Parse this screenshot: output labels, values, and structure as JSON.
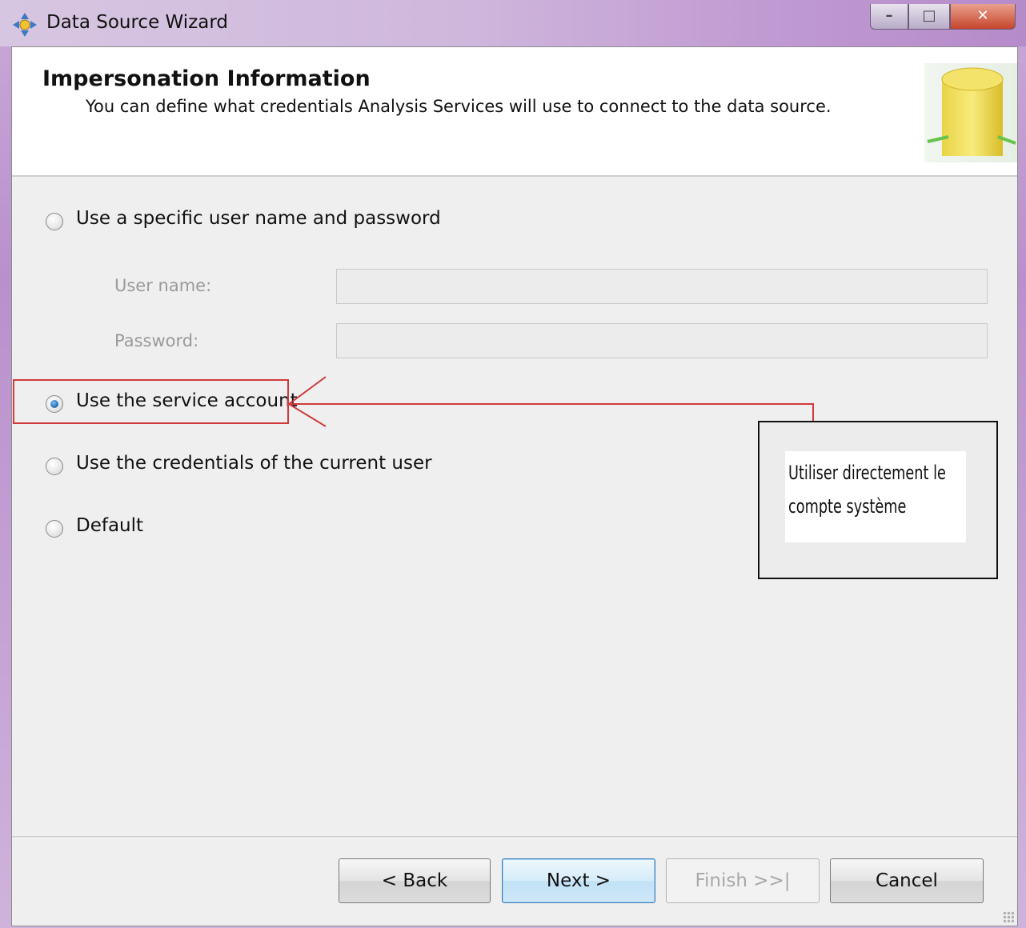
{
  "window": {
    "title": "Data Source Wizard",
    "icon": "wizard-app-icon",
    "controls": {
      "minimize": "minimize-icon",
      "maximize": "maximize-icon",
      "close": "close-icon"
    }
  },
  "header": {
    "title": "Impersonation Information",
    "subtitle": "You can define what credentials Analysis Services will use to connect to the data source.",
    "graphic": "database-cylinder-icon"
  },
  "options": [
    {
      "label": "Use a specific user name and password",
      "selected": false
    },
    {
      "label": "Use the service account",
      "selected": true
    },
    {
      "label": "Use the credentials of the current user",
      "selected": false
    },
    {
      "label": "Default",
      "selected": false
    }
  ],
  "credentials": {
    "username_label": "User name:",
    "password_label": "Password:",
    "username_value": "",
    "password_value": ""
  },
  "annotation": {
    "note_line1": "Utiliser directement le",
    "note_line2": "compte système",
    "highlight_color": "#d13a3a"
  },
  "buttons": {
    "back": "< Back",
    "next": "Next >",
    "finish": "Finish >>|",
    "cancel": "Cancel"
  },
  "colors": {
    "titlebar": "#c09ad2",
    "accent_blue": "#3d7bb5",
    "disabled_text": "#a8a8a8"
  }
}
